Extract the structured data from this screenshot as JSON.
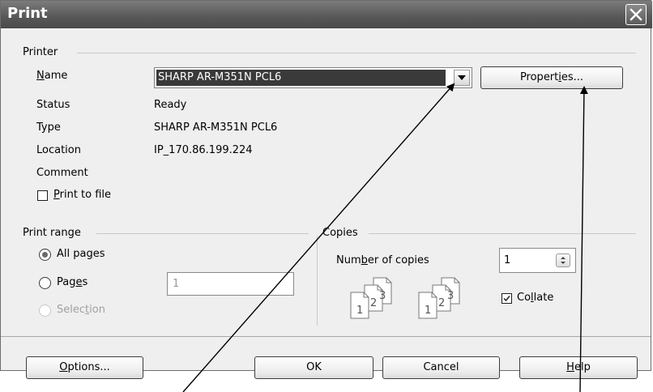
{
  "dialog": {
    "title": "Print",
    "close_icon": "close-icon"
  },
  "printer": {
    "group_label": "Printer",
    "name_label": "Name",
    "name_value": "SHARP AR-M351N PCL6",
    "properties_label": "Properties...",
    "status_label": "Status",
    "status_value": "Ready",
    "type_label": "Type",
    "type_value": "SHARP AR-M351N PCL6",
    "location_label": "Location",
    "location_value": "IP_170.86.199.224",
    "comment_label": "Comment",
    "print_to_file_label": "Print to file",
    "print_to_file_checked": false
  },
  "print_range": {
    "group_label": "Print range",
    "all_pages_label": "All pages",
    "pages_label": "Pages",
    "pages_value": "1",
    "selection_label": "Selection",
    "selected": "All pages"
  },
  "copies": {
    "group_label": "Copies",
    "number_label": "Number of copies",
    "number_value": "1",
    "collate_label": "Collate",
    "collate_checked": true,
    "page_digits": [
      "1",
      "2",
      "3"
    ]
  },
  "buttons": {
    "options": "Options...",
    "ok": "OK",
    "cancel": "Cancel",
    "help": "Help"
  },
  "colors": {
    "titlebar": "#575757",
    "dialog_bg": "#efefef",
    "selection_bg": "#3a3a3a"
  }
}
